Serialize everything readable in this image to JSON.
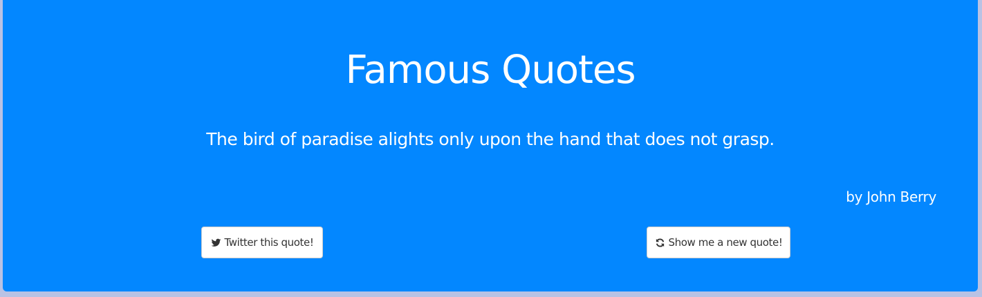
{
  "header": {
    "title": "Famous Quotes"
  },
  "quote": {
    "text": "The bird of paradise alights only upon the hand that does not grasp.",
    "author": "by John Berry"
  },
  "actions": {
    "twitter_label": "Twitter this quote!",
    "twitter_icon": "twitter-icon",
    "new_quote_label": "Show me a new quote!",
    "new_quote_icon": "refresh-icon"
  },
  "colors": {
    "panel_background": "#0387ff",
    "page_background": "#b9c2e4",
    "text": "#ffffff",
    "button_background": "#ffffff",
    "button_text": "#333333"
  }
}
